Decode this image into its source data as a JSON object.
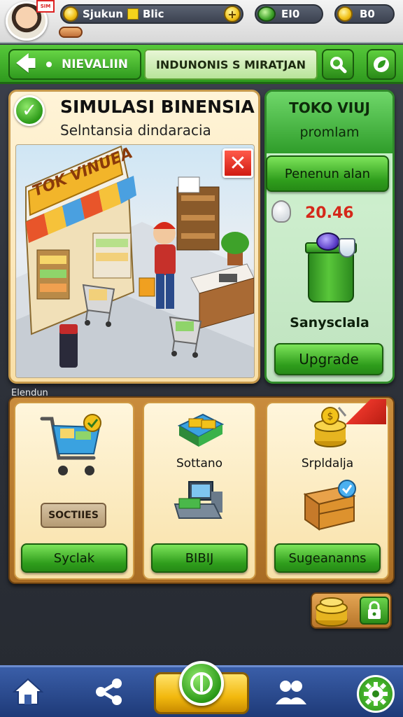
{
  "topbar": {
    "player_tag": "SIM",
    "resource1_label": "Sjukun",
    "resource1_value": "Blic",
    "gem_value": "EI0",
    "coin_value": "B0"
  },
  "nav": {
    "back_label": "NIEVALIIN",
    "title": "INDUNONIS S MIRATJAN"
  },
  "sim_panel": {
    "title": "SIMULASI BINENSIA",
    "subtitle": "Selntansia dindaracia",
    "store_sign": "TOK VINUEA"
  },
  "toko_panel": {
    "title": "TOKO VIUJ",
    "subtitle": "promlam",
    "action_label": "Penenun alan",
    "price": "20.46",
    "item_name": "Sanysclala",
    "upgrade_label": "Upgrade"
  },
  "section": {
    "label": "Elendun"
  },
  "cards": [
    {
      "tag": "SOCTIIES",
      "button": "Syclak"
    },
    {
      "caption": "Sottano",
      "button": "BIBIJ"
    },
    {
      "caption": "Srpldalja",
      "button": "Sugeananns"
    }
  ],
  "colors": {
    "primary_green": "#2f9a1e",
    "accent_gold": "#f2c21a",
    "panel_cream": "#fff4d8",
    "nav_blue": "#1e3a78",
    "alert_red": "#d01b12"
  }
}
